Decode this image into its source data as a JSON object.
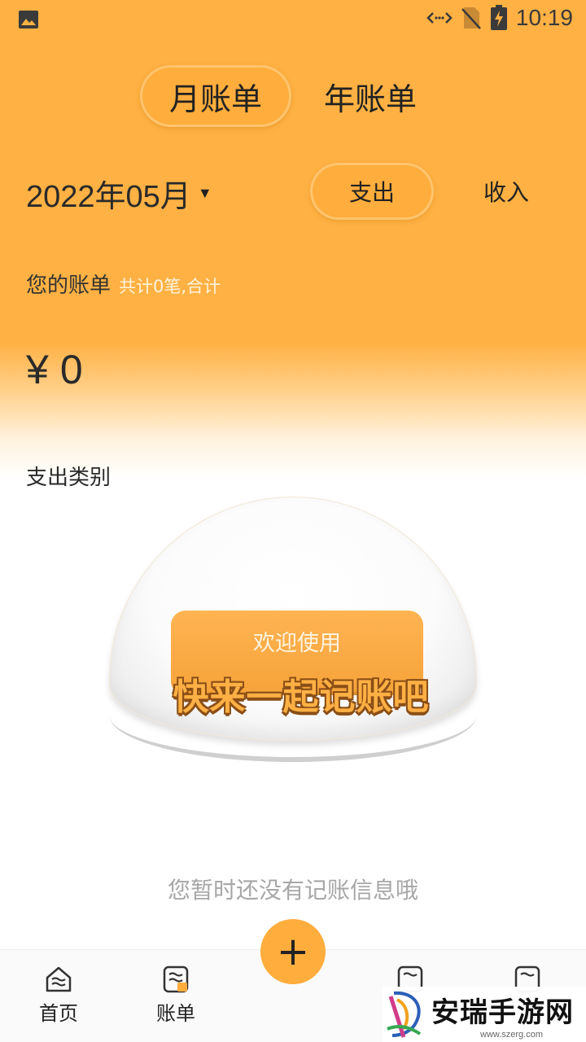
{
  "status_bar": {
    "time": "10:19"
  },
  "tabs": {
    "month": "月账单",
    "year": "年账单"
  },
  "date_row": {
    "date": "2022年05月",
    "expense": "支出",
    "income": "收入"
  },
  "summary": {
    "title": "您的账单",
    "count": "共计0笔,合计"
  },
  "amount": {
    "currency": "¥",
    "value": "0"
  },
  "category": {
    "label": "支出类别"
  },
  "illustration": {
    "top_text": "欢迎使用",
    "main_text": "快来一起记账吧"
  },
  "empty_message": "您暂时还没有记账信息哦",
  "bottom_nav": {
    "home": "首页",
    "bills": "账单",
    "add": "+"
  },
  "watermark": {
    "name": "安瑞手游网",
    "url": "www.szerg.com"
  },
  "colors": {
    "accent": "#ffad3c",
    "background_top": "#ffb143"
  }
}
